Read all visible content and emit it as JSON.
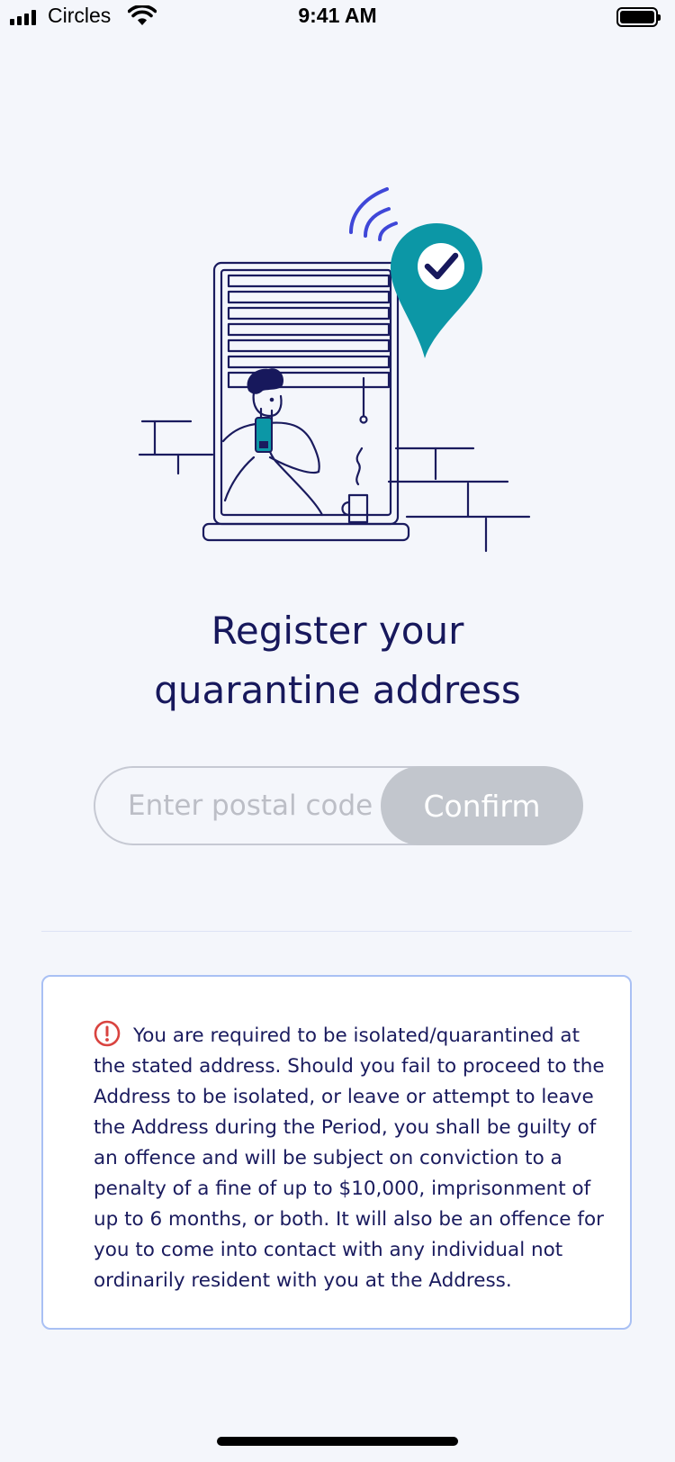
{
  "status_bar": {
    "carrier": "Circles",
    "time": "9:41 AM"
  },
  "main": {
    "title_line1": "Register your",
    "title_line2": "quarantine address"
  },
  "postal": {
    "placeholder": "Enter postal code",
    "value": "",
    "confirm_label": "Confirm"
  },
  "notice": {
    "text": "You are required to be isolated/quarantined at the stated address. Should you fail to proceed to the Address to be isolated, or leave or attempt to leave the Address during the Period, you shall be guilty of an offence and will be subject on conviction to a penalty of a fine of up to $10,000, imprisonment of up to 6 months, or both. It will also be an offence for you to come into contact with any individual not ordinarily resident with you at the Address."
  },
  "colors": {
    "background": "#f4f6fb",
    "title": "#17185c",
    "accent_teal": "#0c97a6",
    "wave_blue": "#3f47d8",
    "button_disabled": "#c2c6cd",
    "warning_red": "#d9433f",
    "card_border": "#a9c0f4"
  },
  "icons": {
    "signal": "signal-bars-icon",
    "wifi": "wifi-icon",
    "battery": "battery-icon",
    "alert": "alert-circle-icon",
    "location_check": "location-pin-check-icon"
  }
}
